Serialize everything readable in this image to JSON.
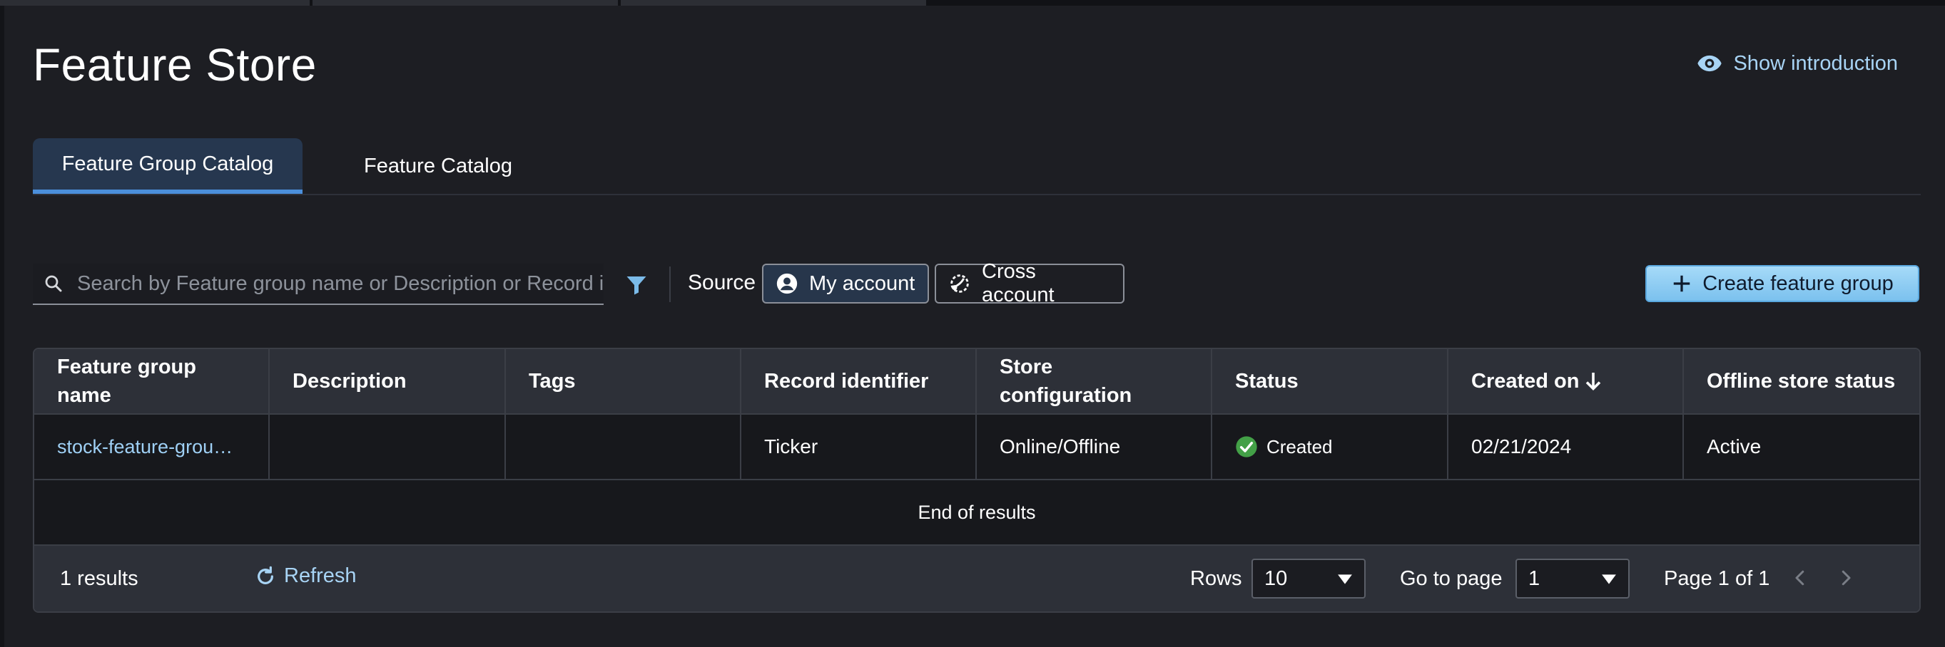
{
  "page": {
    "title": "Feature Store",
    "show_intro_label": "Show introduction"
  },
  "tabs": [
    {
      "label": "Feature Group Catalog",
      "active": true
    },
    {
      "label": "Feature Catalog",
      "active": false
    }
  ],
  "toolbar": {
    "search_placeholder": "Search by Feature group name or Description or Record identifier",
    "search_value": "",
    "source_label": "Source",
    "my_account_label": "My account",
    "cross_account_label": "Cross account",
    "create_label": "Create feature group"
  },
  "table": {
    "columns": [
      "Feature group name",
      "Description",
      "Tags",
      "Record identifier",
      "Store configuration",
      "Status",
      "Created on",
      "Offline store status"
    ],
    "sort_column": "Created on",
    "rows": [
      {
        "name": "stock-feature-grou…",
        "description": "",
        "tags": "",
        "record_identifier": "Ticker",
        "store_configuration": "Online/Offline",
        "status": "Created",
        "created_on": "02/21/2024",
        "offline_store_status": "Active"
      }
    ],
    "end_message": "End of results"
  },
  "footer": {
    "results_text": "1 results",
    "refresh_label": "Refresh",
    "rows_label": "Rows",
    "rows_value": "10",
    "goto_label": "Go to page",
    "goto_value": "1",
    "page_info": "Page 1 of 1"
  },
  "colors": {
    "background": "#1d1e23",
    "accent_link": "#a8d4f5",
    "tab_active": "#26374f",
    "tab_underline": "#4b8fdb",
    "primary_button": "#7bc1ee",
    "status_success": "#43a047"
  },
  "icons": [
    "eye-icon",
    "search-icon",
    "filter-icon",
    "user-circle-icon",
    "cross-account-icon",
    "plus-icon",
    "sort-down-arrow-icon",
    "check-circle-icon",
    "refresh-icon",
    "caret-down-icon",
    "chevron-left-icon",
    "chevron-right-icon"
  ]
}
